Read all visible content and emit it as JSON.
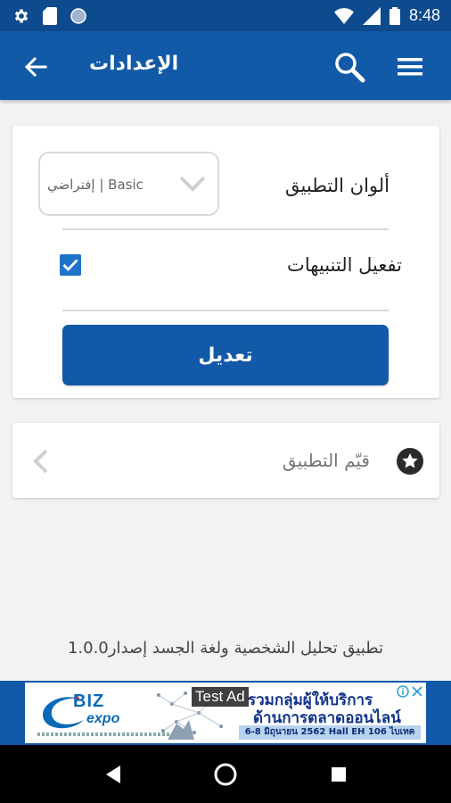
{
  "status_bar": {
    "time": "8:48",
    "left_icons": [
      "gear-icon",
      "sd-card-icon",
      "circle-icon"
    ],
    "right_icons": [
      "wifi-icon",
      "signal-icon",
      "battery-icon"
    ]
  },
  "app_bar": {
    "title": "الإعدادات",
    "back_icon": "arrow-left-icon",
    "search_icon": "search-icon",
    "menu_icon": "menu-icon",
    "background": "#1259a8"
  },
  "settings": {
    "app_colors_label": "ألوان التطبيق",
    "app_colors_value": "إفتراضي | Basic",
    "notifications_label": "تفعيل التنبيهات",
    "notifications_enabled": true,
    "edit_button_label": "تعديل"
  },
  "rate": {
    "label": "قيّم التطبيق",
    "icon": "star-icon"
  },
  "footer": {
    "version_text": "تطبيق تحليل الشخصية ولغة الجسد إصدار1.0.0"
  },
  "ad": {
    "label": "Test Ad",
    "logo_text_1": "BIZ",
    "logo_text_2": "expo",
    "headline_1": "รวมกลุ่มผู้ให้บริการ",
    "headline_2": "ด้านการตลาดออนไลน์",
    "date_line": "6-8 มิถุนายน 2562 Hall EH 106 ไบเทค"
  },
  "nav_bar": {
    "icons": [
      "back-triangle-icon",
      "home-circle-icon",
      "recents-square-icon"
    ]
  },
  "colors": {
    "primary": "#1259a8",
    "status_bar": "#0d4a8e",
    "checkbox": "#1e73c8",
    "background": "#f2f2f2"
  }
}
